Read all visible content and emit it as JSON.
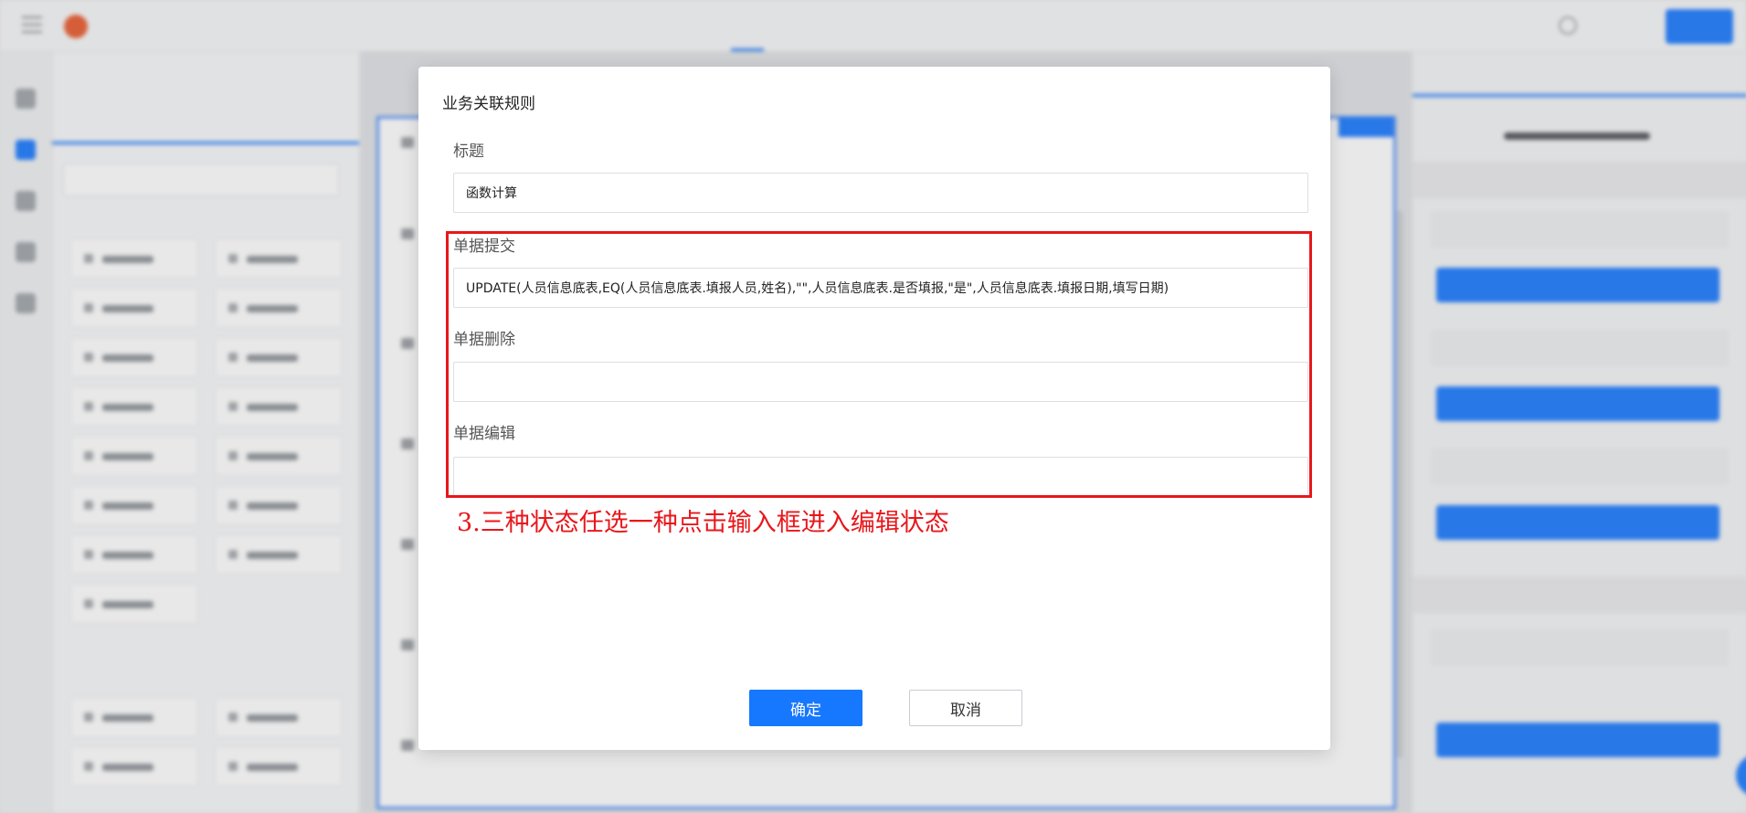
{
  "dialog": {
    "title": "业务关联规则",
    "title_field_label": "标题",
    "title_field_value": "函数计算",
    "submit_label": "单据提交",
    "submit_value": "UPDATE(人员信息底表,EQ(人员信息底表.填报人员,姓名),\"\",人员信息底表.是否填报,\"是\",人员信息底表.填报日期,填写日期)",
    "delete_label": "单据删除",
    "delete_value": "",
    "edit_label": "单据编辑",
    "edit_value": "",
    "confirm_label": "确定",
    "cancel_label": "取消"
  },
  "annotation": {
    "text": "3.三种状态任选一种点击输入框进入编辑状态",
    "color": "#e8171b"
  },
  "colors": {
    "primary": "#1677ff",
    "highlight": "#e8171b"
  },
  "icons": {
    "topbar": [
      "menu-icon",
      "app-logo-icon",
      "help-icon"
    ],
    "rail": [
      "tree-icon",
      "form-icon",
      "database-icon",
      "list-icon",
      "settings-icon"
    ]
  }
}
